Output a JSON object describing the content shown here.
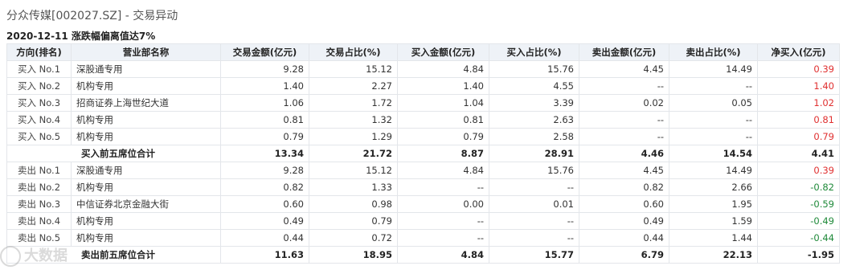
{
  "header": {
    "title": "分众传媒[002027.SZ] - 交易异动",
    "subtitle": "2020-12-11 涨跌幅偏离值达7%"
  },
  "table": {
    "columns": [
      "方向(排名)",
      "营业部名称",
      "交易金额(亿元)",
      "交易占比(%)",
      "买入金额(亿元)",
      "买入占比(%)",
      "卖出金额(亿元)",
      "卖出占比(%)",
      "净买入(亿元)"
    ],
    "rows": [
      {
        "dir": "买入 No.1",
        "name": "深股通专用",
        "trade": "9.28",
        "trade_pct": "15.12",
        "buy": "4.84",
        "buy_pct": "15.76",
        "sell": "4.45",
        "sell_pct": "14.49",
        "net": "0.39",
        "net_sign": "pos"
      },
      {
        "dir": "买入 No.2",
        "name": "机构专用",
        "trade": "1.40",
        "trade_pct": "2.27",
        "buy": "1.40",
        "buy_pct": "4.55",
        "sell": "--",
        "sell_pct": "--",
        "net": "1.40",
        "net_sign": "pos"
      },
      {
        "dir": "买入 No.3",
        "name": "招商证券上海世纪大道",
        "trade": "1.06",
        "trade_pct": "1.72",
        "buy": "1.04",
        "buy_pct": "3.39",
        "sell": "0.02",
        "sell_pct": "0.05",
        "net": "1.02",
        "net_sign": "pos"
      },
      {
        "dir": "买入 No.4",
        "name": "机构专用",
        "trade": "0.81",
        "trade_pct": "1.32",
        "buy": "0.81",
        "buy_pct": "2.63",
        "sell": "--",
        "sell_pct": "--",
        "net": "0.81",
        "net_sign": "pos"
      },
      {
        "dir": "买入 No.5",
        "name": "机构专用",
        "trade": "0.79",
        "trade_pct": "1.29",
        "buy": "0.79",
        "buy_pct": "2.58",
        "sell": "--",
        "sell_pct": "--",
        "net": "0.79",
        "net_sign": "pos"
      },
      {
        "summary": true,
        "name": "买入前五席位合计",
        "trade": "13.34",
        "trade_pct": "21.72",
        "buy": "8.87",
        "buy_pct": "28.91",
        "sell": "4.46",
        "sell_pct": "14.54",
        "net": "4.41",
        "net_sign": "pos"
      },
      {
        "dir": "卖出 No.1",
        "name": "深股通专用",
        "trade": "9.28",
        "trade_pct": "15.12",
        "buy": "4.84",
        "buy_pct": "15.76",
        "sell": "4.45",
        "sell_pct": "14.49",
        "net": "0.39",
        "net_sign": "pos"
      },
      {
        "dir": "卖出 No.2",
        "name": "机构专用",
        "trade": "0.82",
        "trade_pct": "1.33",
        "buy": "--",
        "buy_pct": "--",
        "sell": "0.82",
        "sell_pct": "2.66",
        "net": "-0.82",
        "net_sign": "neg"
      },
      {
        "dir": "卖出 No.3",
        "name": "中信证券北京金融大街",
        "trade": "0.60",
        "trade_pct": "0.98",
        "buy": "0.00",
        "buy_pct": "0.01",
        "sell": "0.60",
        "sell_pct": "1.95",
        "net": "-0.59",
        "net_sign": "neg"
      },
      {
        "dir": "卖出 No.4",
        "name": "机构专用",
        "trade": "0.49",
        "trade_pct": "0.79",
        "buy": "--",
        "buy_pct": "--",
        "sell": "0.49",
        "sell_pct": "1.59",
        "net": "-0.49",
        "net_sign": "neg"
      },
      {
        "dir": "卖出 No.5",
        "name": "机构专用",
        "trade": "0.44",
        "trade_pct": "0.72",
        "buy": "--",
        "buy_pct": "--",
        "sell": "0.44",
        "sell_pct": "1.44",
        "net": "-0.44",
        "net_sign": "neg"
      },
      {
        "summary": true,
        "name": "卖出前五席位合计",
        "trade": "11.63",
        "trade_pct": "18.95",
        "buy": "4.84",
        "buy_pct": "15.77",
        "sell": "6.79",
        "sell_pct": "22.13",
        "net": "-1.95",
        "net_sign": "neg"
      }
    ]
  },
  "colors": {
    "positive": "#e03030",
    "negative": "#1f8a3a",
    "header_bg": "#eef2f7"
  },
  "watermark": {
    "icon": "watermark-logo-icon",
    "text": "大数据"
  }
}
